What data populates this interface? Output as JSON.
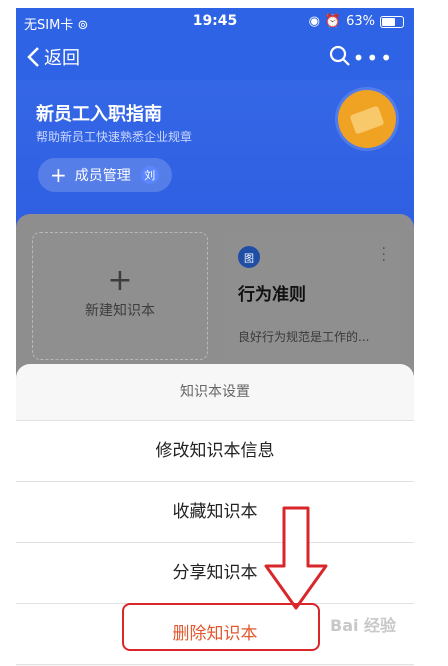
{
  "status_bar": {
    "carrier": "无SIM卡",
    "time": "19:45",
    "battery": "63%"
  },
  "nav": {
    "back_label": "返回"
  },
  "header": {
    "title": "新员工入职指南",
    "subtitle": "帮助新员工快速熟悉企业规章",
    "member_button": "成员管理",
    "member_initial": "刘"
  },
  "cards": {
    "new_label": "新建知识本",
    "rule_icon_text": "图",
    "rule_title": "行为准则",
    "rule_desc": "良好行为规范是工作的..."
  },
  "sheet": {
    "title": "知识本设置",
    "items": [
      {
        "label": "修改知识本信息"
      },
      {
        "label": "收藏知识本"
      },
      {
        "label": "分享知识本"
      },
      {
        "label": "删除知识本"
      }
    ]
  },
  "watermark": "Bai 经验",
  "colors": {
    "brand_blue": "#2f63e6",
    "danger": "#e0592f",
    "highlight_red": "#d9262b"
  }
}
